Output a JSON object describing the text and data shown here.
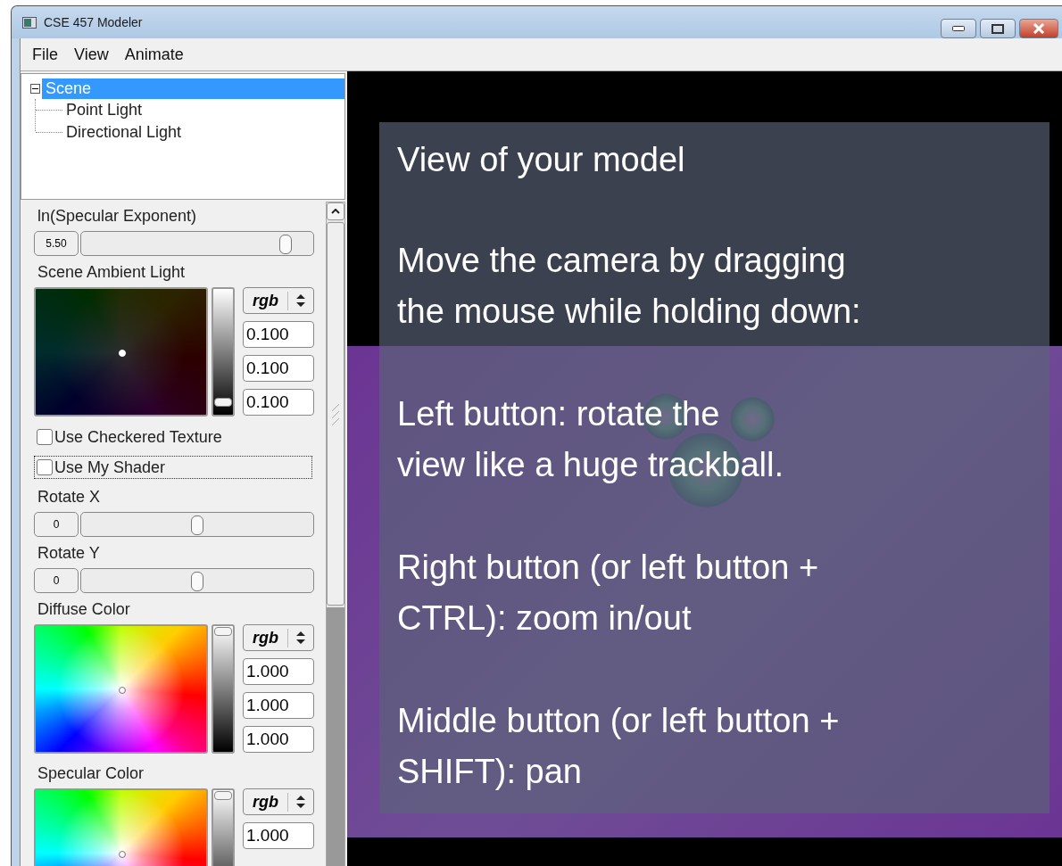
{
  "window": {
    "title": "CSE 457 Modeler"
  },
  "menu": [
    "File",
    "View",
    "Animate"
  ],
  "tree": {
    "label": "Scene",
    "expanded": true,
    "selected": true,
    "children": [
      {
        "label": "Point Light",
        "selected": false
      },
      {
        "label": "Directional Light",
        "selected": false
      }
    ]
  },
  "controls": [
    {
      "kind": "slider",
      "label": "ln(Specular Exponent)",
      "value": "5.50",
      "level": 0.88
    },
    {
      "kind": "color",
      "label": "Scene Ambient Light",
      "mode": "rgb",
      "level": 0.1,
      "values": [
        "0.100",
        "0.100",
        "0.100"
      ]
    },
    {
      "kind": "checkbox",
      "label": "Use Checkered Texture",
      "checked": false,
      "focused": false
    },
    {
      "kind": "checkbox",
      "label": "Use My Shader",
      "checked": false,
      "focused": true
    },
    {
      "kind": "slider",
      "label": "Rotate X",
      "value": "0",
      "level": 0.5
    },
    {
      "kind": "slider",
      "label": "Rotate Y",
      "value": "0",
      "level": 0.5
    },
    {
      "kind": "color",
      "label": "Diffuse Color",
      "mode": "rgb",
      "level": 1,
      "values": [
        "1.000",
        "1.000",
        "1.000"
      ]
    },
    {
      "kind": "color",
      "label": "Specular Color",
      "mode": "rgb",
      "level": 1,
      "values": [
        "1.000"
      ]
    }
  ],
  "overlay": {
    "title": "View of your model",
    "paragraphs": [
      "Move the camera by dragging\nthe mouse while holding down:",
      "Left button: rotate the\nview like a huge trackball.",
      "Right button (or left button +\nCTRL): zoom in/out",
      "Middle button (or left button +\nSHIFT): pan"
    ]
  }
}
